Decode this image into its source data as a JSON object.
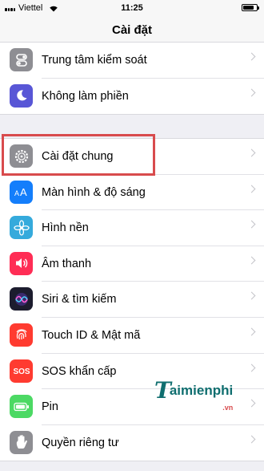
{
  "status_bar": {
    "carrier": "Viettel",
    "time": "11:25"
  },
  "nav": {
    "title": "Cài đặt"
  },
  "group1": [
    {
      "label": "Trung tâm kiểm soát",
      "icon": "control-center-icon",
      "color": "#8e8e93"
    },
    {
      "label": "Không làm phiền",
      "icon": "moon-icon",
      "color": "#5856d6"
    }
  ],
  "group2": [
    {
      "label": "Cài đặt chung",
      "icon": "gear-icon",
      "color": "#8e8e93"
    },
    {
      "label": "Màn hình & độ sáng",
      "icon": "text-size-icon",
      "color": "#147efb"
    },
    {
      "label": "Hình nền",
      "icon": "flower-icon",
      "color": "#35aadc"
    },
    {
      "label": "Âm thanh",
      "icon": "speaker-icon",
      "color": "#ff2d55"
    },
    {
      "label": "Siri & tìm kiếm",
      "icon": "siri-icon",
      "color": "#1c1c2e"
    },
    {
      "label": "Touch ID & Mật mã",
      "icon": "fingerprint-icon",
      "color": "#ff3b30"
    },
    {
      "label": "SOS khẩn cấp",
      "icon": "sos-icon",
      "color": "#ff3b30"
    },
    {
      "label": "Pin",
      "icon": "battery-icon",
      "color": "#4cd964"
    },
    {
      "label": "Quyền riêng tư",
      "icon": "hand-icon",
      "color": "#8e8e93"
    }
  ],
  "watermark": {
    "text_t": "T",
    "text_main": "aimienphi",
    "text_vn": ".vn"
  }
}
